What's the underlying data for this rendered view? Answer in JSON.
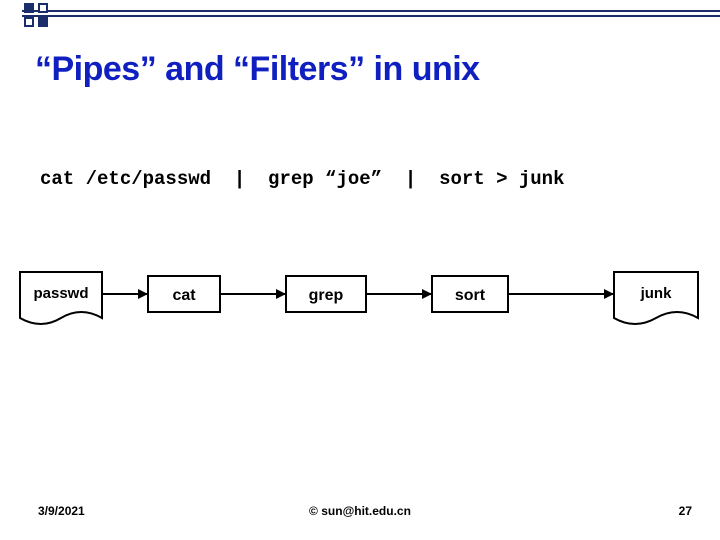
{
  "title": "“Pipes” and “Filters” in unix",
  "command_line": "cat /etc/passwd  |  grep “joe”  |  sort > junk",
  "diagram": {
    "input_doc": "passwd",
    "filters": [
      "cat",
      "grep",
      "sort"
    ],
    "output_doc": "junk"
  },
  "footer": {
    "date": "3/9/2021",
    "credit": "© sun@hit.edu.cn",
    "page": "27"
  }
}
